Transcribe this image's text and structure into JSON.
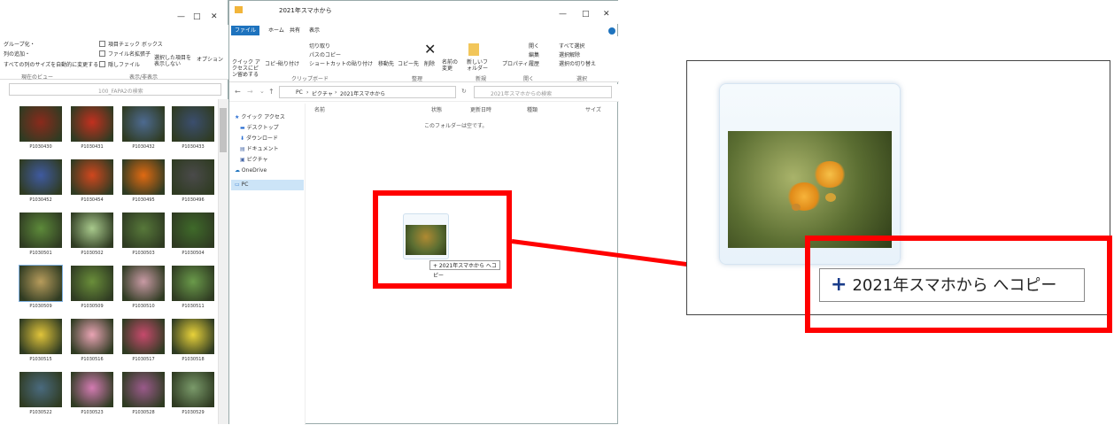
{
  "left_window": {
    "window_controls": [
      "—",
      "□",
      "✕"
    ],
    "ribbon": {
      "rows": [
        "グループ化・",
        "列の追加・",
        "すべての列のサイズを自動的に変更する",
        "項目チェック ボックス",
        "ファイル名拡張子",
        "隠しファイル",
        "選択した項目を表示しない",
        "オプション"
      ],
      "groups": [
        "現在のビュー",
        "表示/非表示"
      ]
    },
    "search_placeholder": "100_FAPA2の検索",
    "photo_labels": [
      [
        "P1030430",
        "P1030431",
        "P1030432",
        "P1030433"
      ],
      [
        "P1030452",
        "P1030454",
        "P1030495",
        "P1030496"
      ],
      [
        "P1030501",
        "P1030502",
        "P1030503",
        "P1030504"
      ],
      [
        "P1030509",
        "P1030509",
        "P1030510",
        "P1030511"
      ],
      [
        "P1030515",
        "P1030516",
        "P1030517",
        "P1030518"
      ],
      [
        "P1030522",
        "P1030523",
        "P1030528",
        "P1030529"
      ]
    ]
  },
  "right_window": {
    "title": "2021年スマホから",
    "tabs": [
      "ファイル",
      "ホーム",
      "共有",
      "表示"
    ],
    "ribbon": {
      "buttons": [
        "クイック アクセスにピン留めする",
        "コピー",
        "貼り付け",
        "切り取り",
        "パスのコピー",
        "ショートカットの貼り付け",
        "移動先",
        "コピー先",
        "削除",
        "名前の変更",
        "新しいフォルダー",
        "プロパティ",
        "開く",
        "編集",
        "履歴",
        "すべて選択",
        "選択解除",
        "選択の切り替え"
      ],
      "groups": [
        "クリップボード",
        "整理",
        "新規",
        "開く",
        "選択"
      ]
    },
    "breadcrumb": [
      "PC",
      "ピクチャ",
      "2021年スマホから"
    ],
    "search_placeholder": "2021年スマホからの検索",
    "nav_items": [
      "クイック アクセス",
      "デスクトップ",
      "ダウンロード",
      "ドキュメント",
      "ピクチャ",
      "OneDrive",
      "PC"
    ],
    "columns": [
      "名前",
      "状態",
      "更新日時",
      "種類",
      "サイズ"
    ],
    "empty_message": "このフォルダーは空です。",
    "drag_tooltip": "+ 2021年スマホから へコピー"
  },
  "zoom_panel": {
    "copy_tooltip": "2021年スマホから へコピー",
    "plus": "+"
  },
  "colors": {
    "highlight": "#ff0000",
    "accent": "#1e73be",
    "tooltip_plus": "#1a3c8a"
  }
}
